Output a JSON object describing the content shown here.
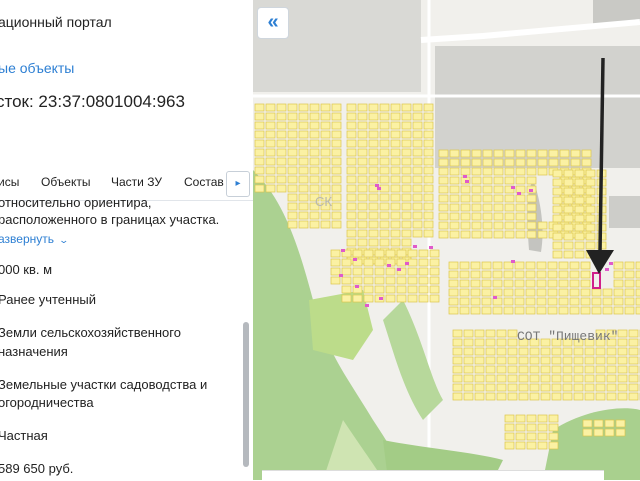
{
  "panel": {
    "portal_title": "ационный портал",
    "back_link": "ые объекты",
    "parcel_title": "сток: 23:37:0801004:963",
    "tabs": [
      {
        "label": "исы"
      },
      {
        "label": "Объекты"
      },
      {
        "label": "Части ЗУ"
      },
      {
        "label": "Состав"
      }
    ],
    "tab_next": "▸",
    "address_line1": "относительно ориентира,",
    "address_line2": "расположенного в границах участка.",
    "expand_label": "азвернуть",
    "area": "000 кв. м",
    "status": "Ранее учтенный",
    "category_line1": "Земли сельскохозяйственного",
    "category_line2": "назначения",
    "use_line1": "Земельные участки садоводства и",
    "use_line2": "огородничества",
    "ownership": "Частная",
    "cost": "589 650 руб."
  },
  "map": {
    "collapse_label": "«",
    "label_snt": "СОТ \"Пищевик\"",
    "label_ski": "СК",
    "colors": {
      "parcel_fill": "#fbf1a3",
      "parcel_stroke": "#dcc54a",
      "forest": "#a9d08e",
      "industrial": "#dadad6",
      "building": "#c4c4c0",
      "selected": "#d0208a",
      "pink": "#e05acb"
    }
  }
}
